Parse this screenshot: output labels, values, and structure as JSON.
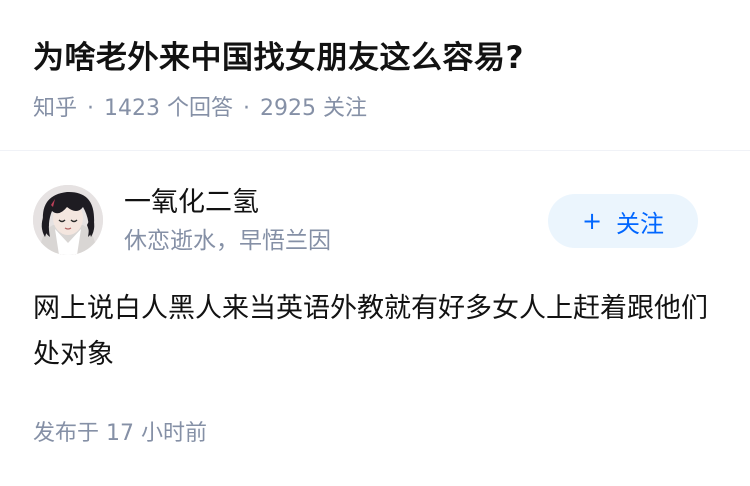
{
  "question": {
    "title": "为啥老外来中国找女朋友这么容易?",
    "source": "知乎",
    "separator": "·",
    "answer_count": "1423",
    "answer_label": "个回答",
    "follower_count": "2925",
    "follower_label": "关注"
  },
  "author": {
    "name": "一氧化二氢",
    "bio": "休恋逝水，早悟兰因",
    "avatar_icon": "anime-avatar-icon",
    "follow_icon": "plus",
    "follow_label": "关注"
  },
  "answer": {
    "content": "网上说白人黑人来当英语外教就有好多女人上赶着跟他们处对象",
    "publish_prefix": "发布于",
    "publish_time": "17 小时前"
  },
  "colors": {
    "text": "#121212",
    "muted": "#8590a6",
    "accent": "#0066ff",
    "button_bg": "#ebf5fd"
  }
}
